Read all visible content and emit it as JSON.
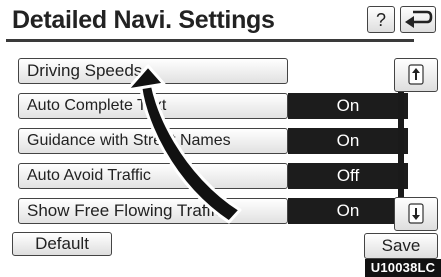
{
  "header": {
    "title": "Detailed Navi. Settings",
    "help_label": "?",
    "back_icon": "u-turn-back-icon"
  },
  "settings": [
    {
      "label": "Driving Speeds",
      "value": null
    },
    {
      "label": "Auto Complete Text",
      "value": "On"
    },
    {
      "label": "Guidance with Street Names",
      "value": "On"
    },
    {
      "label": "Auto Avoid Traffic",
      "value": "Off"
    },
    {
      "label": "Show Free Flowing Traffic",
      "value": "On"
    }
  ],
  "scroll": {
    "up_icon": "scroll-up-icon",
    "down_icon": "scroll-down-icon"
  },
  "footer": {
    "default_label": "Default",
    "save_label": "Save"
  },
  "image_code": "U10038LC",
  "colors": {
    "value_bg": "#1c1c1c",
    "arrow_fill": "#111111"
  }
}
